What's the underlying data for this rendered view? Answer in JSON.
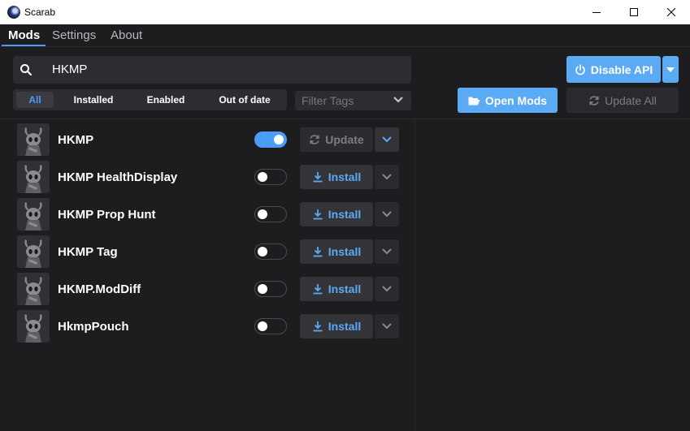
{
  "window": {
    "title": "Scarab"
  },
  "menu": {
    "tabs": [
      "Mods",
      "Settings",
      "About"
    ]
  },
  "search": {
    "value": "HKMP",
    "placeholder": ""
  },
  "filters": {
    "buttons": [
      "All",
      "Installed",
      "Enabled",
      "Out of date"
    ],
    "active": "All",
    "tags_placeholder": "Filter Tags"
  },
  "actions": {
    "disable_api": "Disable API",
    "open_mods": "Open Mods",
    "update_all": "Update All"
  },
  "mods": [
    {
      "name": "HKMP",
      "enabled": true,
      "action": "Update",
      "action_state": "disabled"
    },
    {
      "name": "HKMP HealthDisplay",
      "enabled": false,
      "action": "Install",
      "action_state": "enabled"
    },
    {
      "name": "HKMP Prop Hunt",
      "enabled": false,
      "action": "Install",
      "action_state": "enabled"
    },
    {
      "name": "HKMP Tag",
      "enabled": false,
      "action": "Install",
      "action_state": "enabled"
    },
    {
      "name": "HKMP.ModDiff",
      "enabled": false,
      "action": "Install",
      "action_state": "enabled"
    },
    {
      "name": "HkmpPouch",
      "enabled": false,
      "action": "Install",
      "action_state": "enabled"
    }
  ],
  "colors": {
    "accent": "#4a9cf5",
    "primary_button": "#5aaaf4",
    "background": "#1d1d20",
    "surface": "#2d2d31"
  },
  "icons": {
    "app": "scarab-logo-icon",
    "search": "search-icon",
    "power": "power-icon",
    "folder": "folder-open-icon",
    "refresh": "refresh-icon",
    "download": "download-icon",
    "chevron": "chevron-down-icon"
  }
}
